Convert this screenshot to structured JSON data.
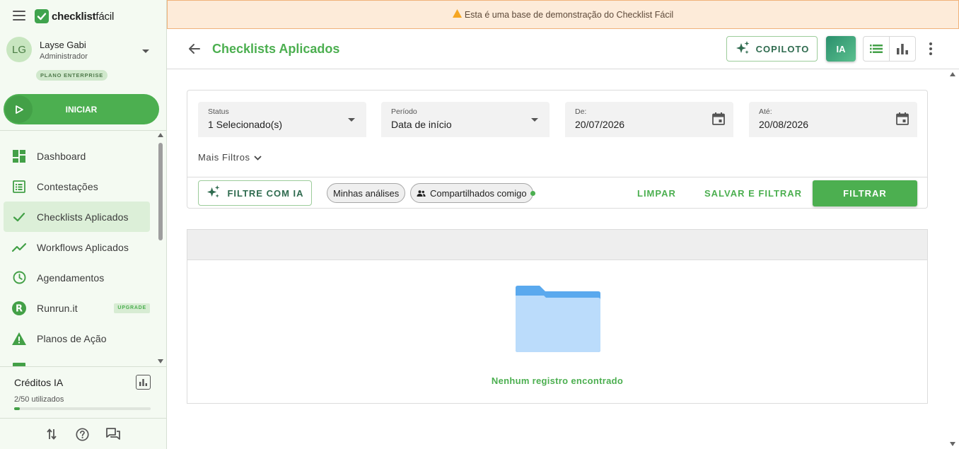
{
  "brand": {
    "logo_bold": "checklist",
    "logo_light": "fácil"
  },
  "user": {
    "initials": "LG",
    "name": "Layse Gabi",
    "role": "Administrador",
    "plan": "PLANO ENTERPRISE"
  },
  "sidebar": {
    "start_label": "INICIAR",
    "items": [
      {
        "label": "Dashboard",
        "icon": "dashboard-icon"
      },
      {
        "label": "Contestações",
        "icon": "list-alt-icon"
      },
      {
        "label": "Checklists Aplicados",
        "icon": "check-icon",
        "active": true
      },
      {
        "label": "Workflows Aplicados",
        "icon": "trending-icon"
      },
      {
        "label": "Agendamentos",
        "icon": "clock-icon"
      },
      {
        "label": "Runrun.it",
        "icon": "runrunit-icon",
        "badge": "UPGRADE"
      },
      {
        "label": "Planos de Ação",
        "icon": "warning-icon"
      }
    ],
    "credits": {
      "title": "Créditos IA",
      "used_text": "2/50 utilizados",
      "used": 2,
      "total": 50
    }
  },
  "banner": {
    "text": "Esta é uma base de demonstração do Checklist Fácil"
  },
  "header": {
    "title": "Checklists Aplicados",
    "copiloto_label": "COPILOTO",
    "ia_label": "IA"
  },
  "filters": {
    "status": {
      "label": "Status",
      "value": "1 Selecionado(s)"
    },
    "period": {
      "label": "Período",
      "value": "Data de início"
    },
    "from": {
      "label": "De:",
      "value": "20/07/2026"
    },
    "to": {
      "label": "Até:",
      "value": "20/08/2026"
    },
    "more_label": "Mais Filtros",
    "ai_filter_label": "FILTRE COM IA",
    "chips": [
      "Minhas análises",
      "Compartilhados comigo"
    ],
    "clear_label": "LIMPAR",
    "save_filter_label": "SALVAR E FILTRAR",
    "filter_label": "FILTRAR"
  },
  "results": {
    "empty_message": "Nenhum registro encontrado"
  },
  "colors": {
    "accent": "#4caf50",
    "banner_bg": "#fdebd9",
    "warning": "#f5a623"
  }
}
